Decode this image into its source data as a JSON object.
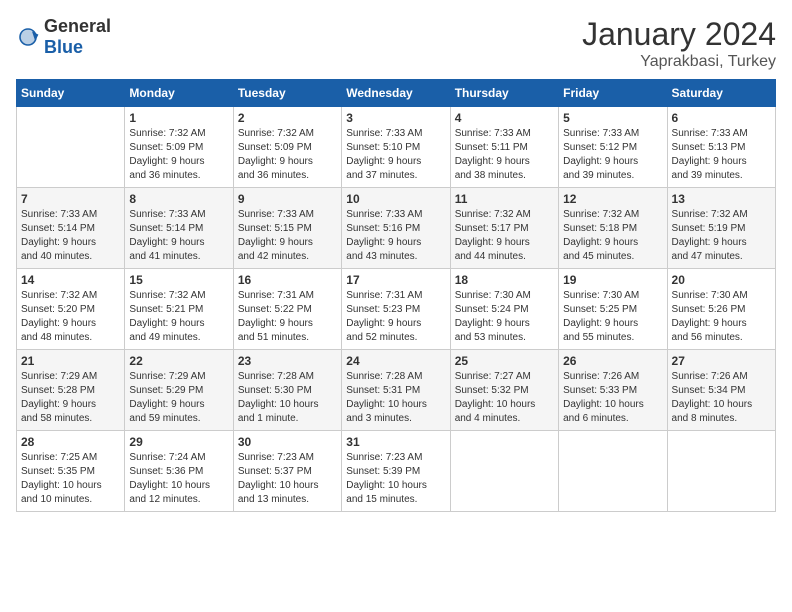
{
  "header": {
    "logo_general": "General",
    "logo_blue": "Blue",
    "month_year": "January 2024",
    "location": "Yaprakbasi, Turkey"
  },
  "days_of_week": [
    "Sunday",
    "Monday",
    "Tuesday",
    "Wednesday",
    "Thursday",
    "Friday",
    "Saturday"
  ],
  "weeks": [
    [
      {
        "day": "",
        "info": ""
      },
      {
        "day": "1",
        "info": "Sunrise: 7:32 AM\nSunset: 5:09 PM\nDaylight: 9 hours\nand 36 minutes."
      },
      {
        "day": "2",
        "info": "Sunrise: 7:32 AM\nSunset: 5:09 PM\nDaylight: 9 hours\nand 36 minutes."
      },
      {
        "day": "3",
        "info": "Sunrise: 7:33 AM\nSunset: 5:10 PM\nDaylight: 9 hours\nand 37 minutes."
      },
      {
        "day": "4",
        "info": "Sunrise: 7:33 AM\nSunset: 5:11 PM\nDaylight: 9 hours\nand 38 minutes."
      },
      {
        "day": "5",
        "info": "Sunrise: 7:33 AM\nSunset: 5:12 PM\nDaylight: 9 hours\nand 39 minutes."
      },
      {
        "day": "6",
        "info": "Sunrise: 7:33 AM\nSunset: 5:13 PM\nDaylight: 9 hours\nand 39 minutes."
      }
    ],
    [
      {
        "day": "7",
        "info": "Sunrise: 7:33 AM\nSunset: 5:14 PM\nDaylight: 9 hours\nand 40 minutes."
      },
      {
        "day": "8",
        "info": "Sunrise: 7:33 AM\nSunset: 5:14 PM\nDaylight: 9 hours\nand 41 minutes."
      },
      {
        "day": "9",
        "info": "Sunrise: 7:33 AM\nSunset: 5:15 PM\nDaylight: 9 hours\nand 42 minutes."
      },
      {
        "day": "10",
        "info": "Sunrise: 7:33 AM\nSunset: 5:16 PM\nDaylight: 9 hours\nand 43 minutes."
      },
      {
        "day": "11",
        "info": "Sunrise: 7:32 AM\nSunset: 5:17 PM\nDaylight: 9 hours\nand 44 minutes."
      },
      {
        "day": "12",
        "info": "Sunrise: 7:32 AM\nSunset: 5:18 PM\nDaylight: 9 hours\nand 45 minutes."
      },
      {
        "day": "13",
        "info": "Sunrise: 7:32 AM\nSunset: 5:19 PM\nDaylight: 9 hours\nand 47 minutes."
      }
    ],
    [
      {
        "day": "14",
        "info": "Sunrise: 7:32 AM\nSunset: 5:20 PM\nDaylight: 9 hours\nand 48 minutes."
      },
      {
        "day": "15",
        "info": "Sunrise: 7:32 AM\nSunset: 5:21 PM\nDaylight: 9 hours\nand 49 minutes."
      },
      {
        "day": "16",
        "info": "Sunrise: 7:31 AM\nSunset: 5:22 PM\nDaylight: 9 hours\nand 51 minutes."
      },
      {
        "day": "17",
        "info": "Sunrise: 7:31 AM\nSunset: 5:23 PM\nDaylight: 9 hours\nand 52 minutes."
      },
      {
        "day": "18",
        "info": "Sunrise: 7:30 AM\nSunset: 5:24 PM\nDaylight: 9 hours\nand 53 minutes."
      },
      {
        "day": "19",
        "info": "Sunrise: 7:30 AM\nSunset: 5:25 PM\nDaylight: 9 hours\nand 55 minutes."
      },
      {
        "day": "20",
        "info": "Sunrise: 7:30 AM\nSunset: 5:26 PM\nDaylight: 9 hours\nand 56 minutes."
      }
    ],
    [
      {
        "day": "21",
        "info": "Sunrise: 7:29 AM\nSunset: 5:28 PM\nDaylight: 9 hours\nand 58 minutes."
      },
      {
        "day": "22",
        "info": "Sunrise: 7:29 AM\nSunset: 5:29 PM\nDaylight: 9 hours\nand 59 minutes."
      },
      {
        "day": "23",
        "info": "Sunrise: 7:28 AM\nSunset: 5:30 PM\nDaylight: 10 hours\nand 1 minute."
      },
      {
        "day": "24",
        "info": "Sunrise: 7:28 AM\nSunset: 5:31 PM\nDaylight: 10 hours\nand 3 minutes."
      },
      {
        "day": "25",
        "info": "Sunrise: 7:27 AM\nSunset: 5:32 PM\nDaylight: 10 hours\nand 4 minutes."
      },
      {
        "day": "26",
        "info": "Sunrise: 7:26 AM\nSunset: 5:33 PM\nDaylight: 10 hours\nand 6 minutes."
      },
      {
        "day": "27",
        "info": "Sunrise: 7:26 AM\nSunset: 5:34 PM\nDaylight: 10 hours\nand 8 minutes."
      }
    ],
    [
      {
        "day": "28",
        "info": "Sunrise: 7:25 AM\nSunset: 5:35 PM\nDaylight: 10 hours\nand 10 minutes."
      },
      {
        "day": "29",
        "info": "Sunrise: 7:24 AM\nSunset: 5:36 PM\nDaylight: 10 hours\nand 12 minutes."
      },
      {
        "day": "30",
        "info": "Sunrise: 7:23 AM\nSunset: 5:37 PM\nDaylight: 10 hours\nand 13 minutes."
      },
      {
        "day": "31",
        "info": "Sunrise: 7:23 AM\nSunset: 5:39 PM\nDaylight: 10 hours\nand 15 minutes."
      },
      {
        "day": "",
        "info": ""
      },
      {
        "day": "",
        "info": ""
      },
      {
        "day": "",
        "info": ""
      }
    ]
  ]
}
